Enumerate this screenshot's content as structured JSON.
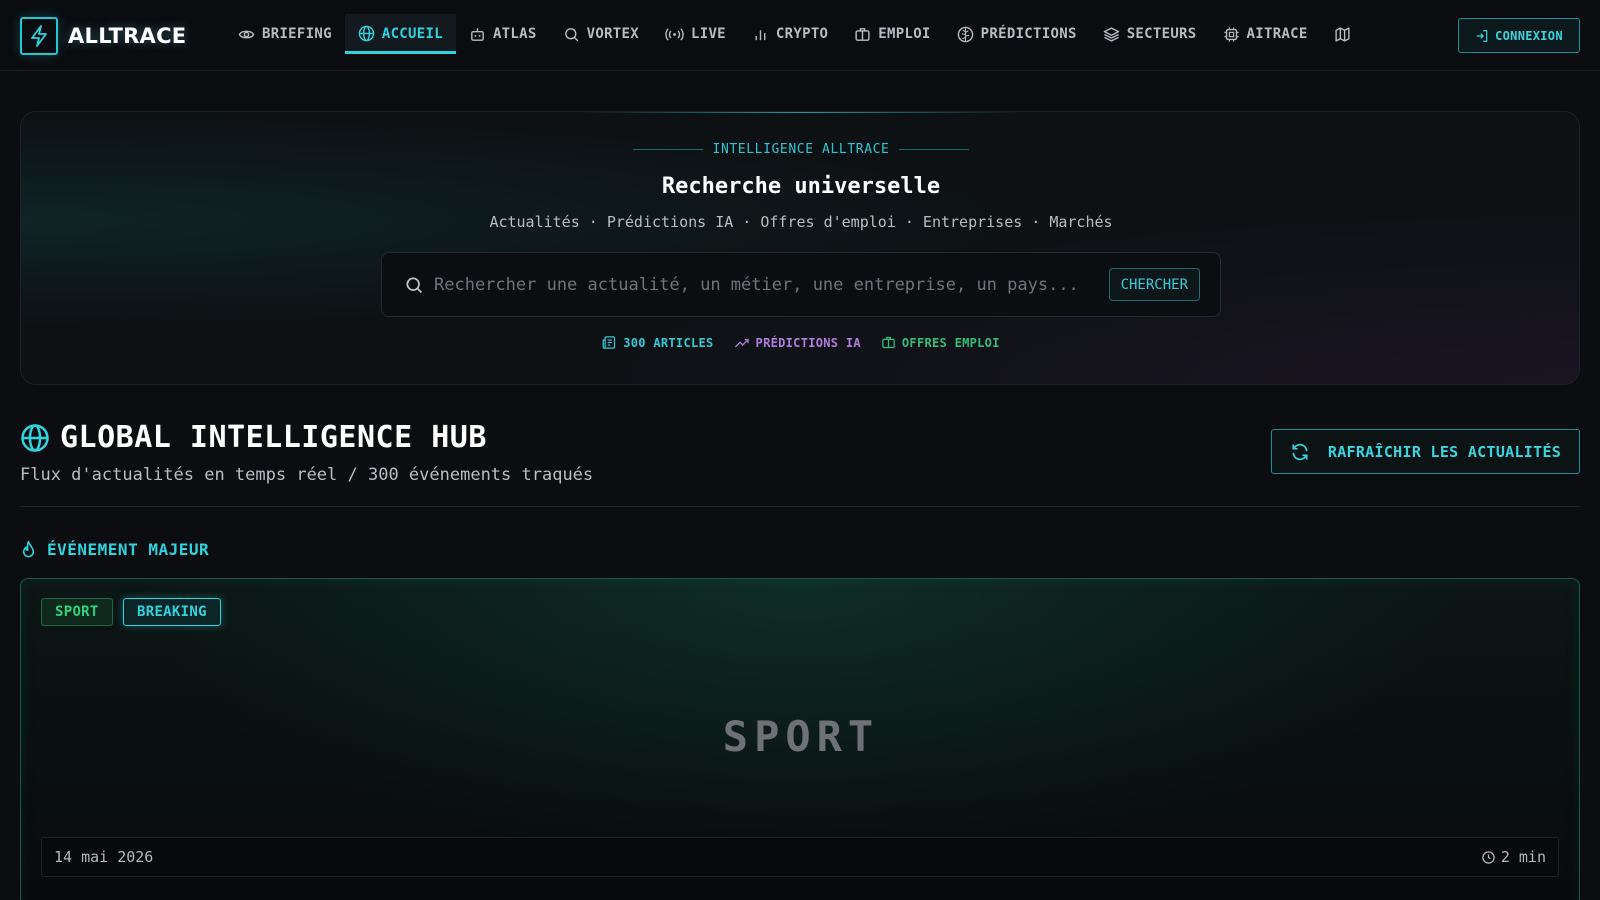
{
  "brand": {
    "name": "ALLTRACE"
  },
  "nav": {
    "items": [
      {
        "label": "BRIEFING",
        "icon": "eye-icon"
      },
      {
        "label": "ACCUEIL",
        "icon": "globe-icon",
        "active": true
      },
      {
        "label": "ATLAS",
        "icon": "robot-icon"
      },
      {
        "label": "VORTEX",
        "icon": "search-icon"
      },
      {
        "label": "LIVE",
        "icon": "broadcast-icon"
      },
      {
        "label": "CRYPTO",
        "icon": "bar-chart-icon"
      },
      {
        "label": "EMPLOI",
        "icon": "briefcase-icon"
      },
      {
        "label": "PRÉDICTIONS",
        "icon": "brain-icon"
      },
      {
        "label": "SECTEURS",
        "icon": "layers-icon"
      },
      {
        "label": "AITRACE",
        "icon": "chip-icon"
      }
    ],
    "extra_icon": "map-icon",
    "login_label": "CONNEXION"
  },
  "hero": {
    "kicker": "INTELLIGENCE ALLTRACE",
    "title": "Recherche universelle",
    "subtitle": "Actualités · Prédictions IA · Offres d'emploi · Entreprises · Marchés",
    "search": {
      "placeholder": "Rechercher une actualité, un métier, une entreprise, un pays...",
      "value": "",
      "button_label": "CHERCHER"
    },
    "badges": [
      {
        "label": "300 ARTICLES",
        "icon": "news-icon",
        "color": "#34c9d6"
      },
      {
        "label": "PRÉDICTIONS IA",
        "icon": "trend-up-icon",
        "color": "#b07ddb"
      },
      {
        "label": "OFFRES EMPLOI",
        "icon": "briefcase-icon",
        "color": "#2fbf7a"
      }
    ]
  },
  "hub": {
    "title": "GLOBAL INTELLIGENCE HUB",
    "subtitle": "Flux d'actualités en temps réel / 300 événements traqués",
    "refresh_label": "RAFRAÎCHIR LES ACTUALITÉS"
  },
  "major_event": {
    "section_label": "ÉVÉNEMENT MAJEUR",
    "tags": [
      "SPORT",
      "BREAKING"
    ],
    "image_text": "SPORT",
    "date": "14 mai 2026",
    "read_time": "2 min"
  },
  "colors": {
    "accent": "#2fd3e0",
    "background": "#0b0d10",
    "sport_green": "#2fd27d",
    "purple": "#b07ddb"
  }
}
